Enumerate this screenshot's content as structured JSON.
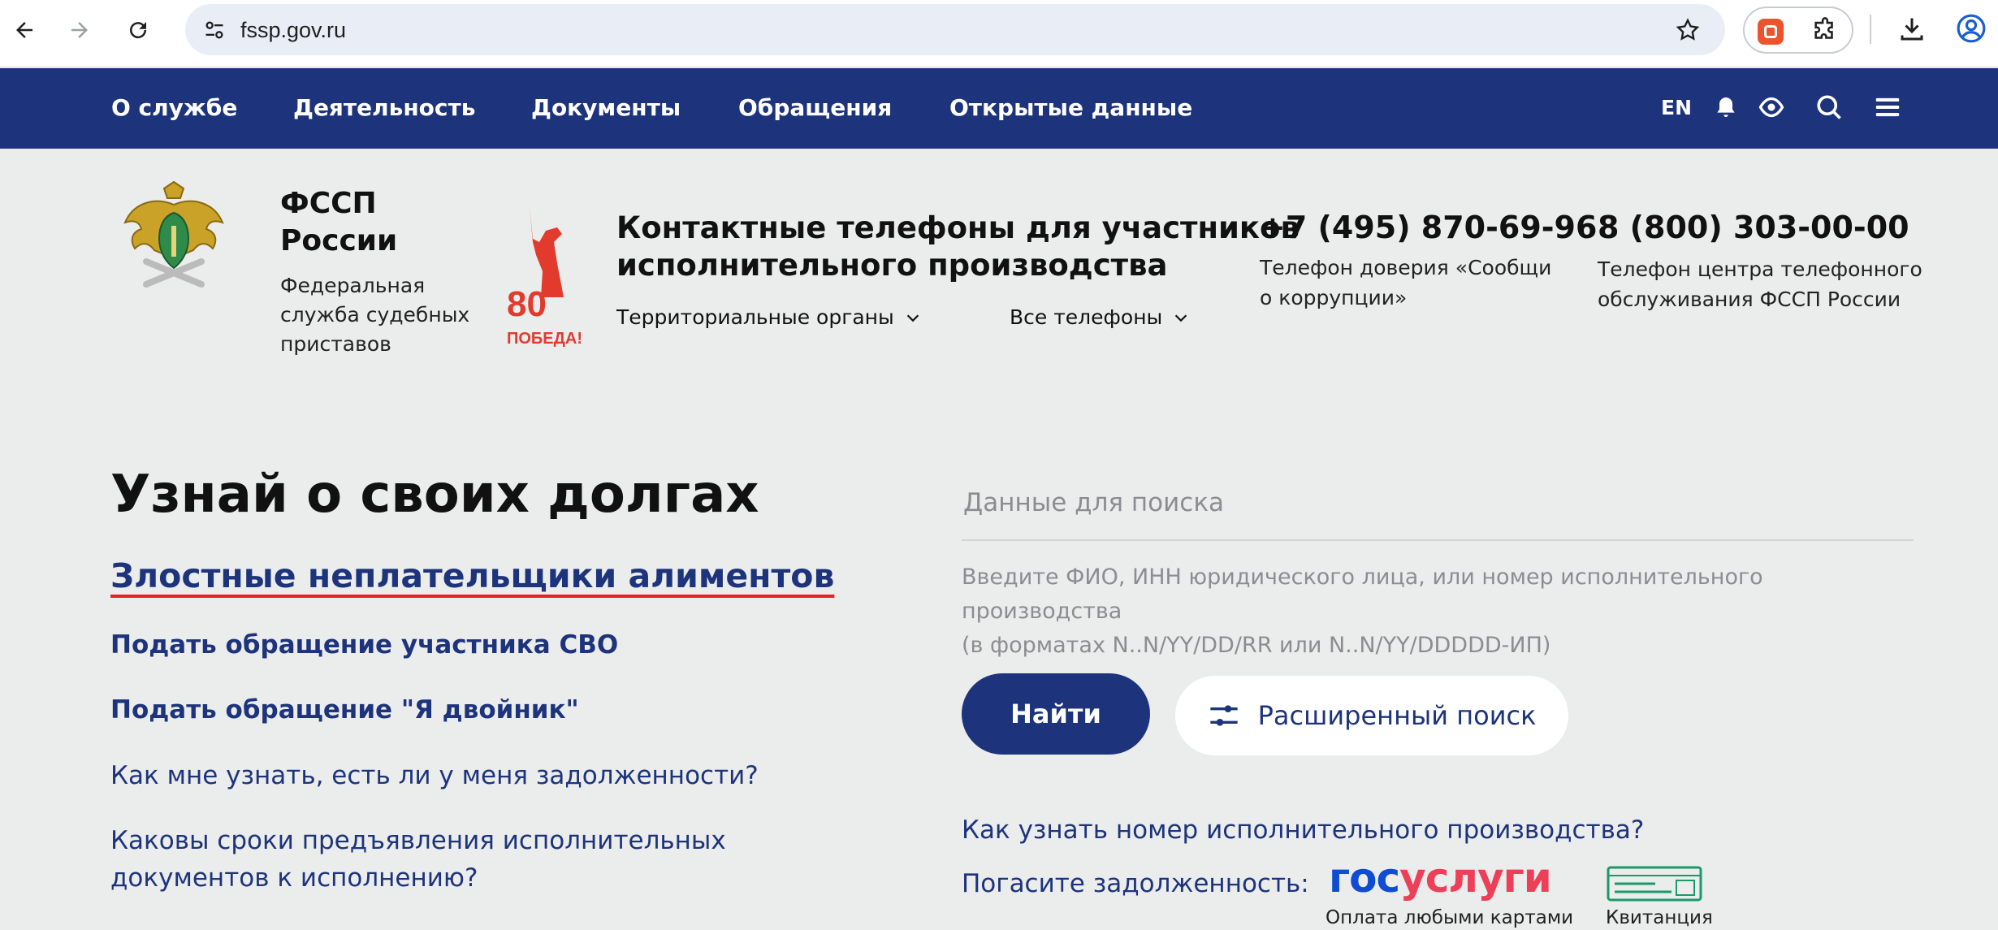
{
  "browser": {
    "url": "fssp.gov.ru"
  },
  "nav": {
    "items": [
      {
        "label": "О службе"
      },
      {
        "label": "Деятельность"
      },
      {
        "label": "Документы"
      },
      {
        "label": "Обращения"
      },
      {
        "label": "Открытые данные"
      }
    ],
    "lang": "EN"
  },
  "header": {
    "org_name_line1": "ФССП",
    "org_name_line2": "России",
    "org_sub_line1": "Федеральная",
    "org_sub_line2": "служба судебных",
    "org_sub_line3": "приставов",
    "victory_number": "80",
    "victory_text": "ПОБЕДА!",
    "contact_title_line1": "Контактные телефоны для участников",
    "contact_title_line2": "исполнительного производства",
    "dropdown_territorial": "Территориальные органы",
    "dropdown_all_phones": "Все телефоны",
    "phone1": "+7 (495) 870-69-96",
    "phone1_desc_line1": "Телефон доверия «Сообщи",
    "phone1_desc_line2": "о коррупции»",
    "phone2": "8 (800) 303-00-00",
    "phone2_desc_line1": "Телефон центра телефонного",
    "phone2_desc_line2": "обслуживания ФССП России"
  },
  "main": {
    "title": "Узнай о своих долгах",
    "links": {
      "alimony": "Злостные неплательщики алиментов",
      "svo": "Подать обращение участника СВО",
      "double": "Подать обращение \"Я двойник\"",
      "how_debts": "Как мне узнать, есть ли у меня задолженности?",
      "terms_line1": "Каковы сроки предъявления исполнительных",
      "terms_line2": "документов к исполнению?"
    },
    "search": {
      "placeholder": "Данные для поиска",
      "hint_line1": "Введите ФИО, ИНН юридического лица, или номер исполнительного производства",
      "hint_line2": "(в форматах N..N/YY/DD/RR или N..N/YY/DDDDD-ИП)",
      "find_label": "Найти",
      "advanced_label": "Расширенный поиск"
    },
    "howto_link": "Как узнать номер исполнительного производства?",
    "pay": {
      "label": "Погасите задолженность:",
      "gos_part1": "гос",
      "gos_part2": "услуги",
      "gos_sub": "Оплата любыми картами",
      "kvit_sub": "Квитанция"
    }
  },
  "colors": {
    "brand_navy": "#1d347c",
    "accent_red": "#e0242e",
    "gos_blue": "#0d4cd3",
    "gos_red": "#ee3f58",
    "kvit_green": "#1a9a6a"
  }
}
